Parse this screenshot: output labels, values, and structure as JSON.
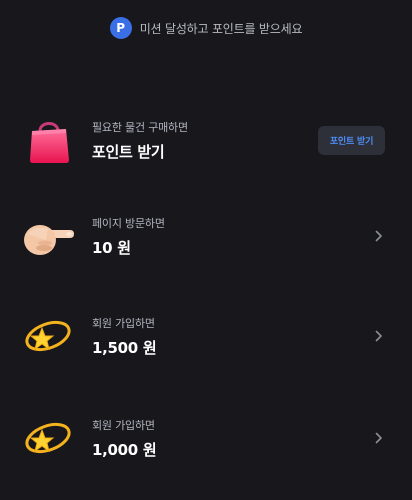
{
  "header": {
    "badge_letter": "P",
    "text": "미션 달성하고 포인트를 받으세요"
  },
  "missions": [
    {
      "subtitle": "필요한 물건 구매하면",
      "title": "포인트 받기",
      "icon": "shopping-bag-icon",
      "button_label": "포인트 받기"
    },
    {
      "subtitle": "페이지 방문하면",
      "title": "10 원",
      "icon": "pointing-hand-icon"
    },
    {
      "subtitle": "회원 가입하면",
      "title": "1,500 원",
      "icon": "dizzy-star-icon"
    },
    {
      "subtitle": "회원 가입하면",
      "title": "1,000 원",
      "icon": "dizzy-star-icon"
    }
  ],
  "colors": {
    "background": "#17171c",
    "accent": "#3b6fe6",
    "button_text": "#4f8df6"
  }
}
